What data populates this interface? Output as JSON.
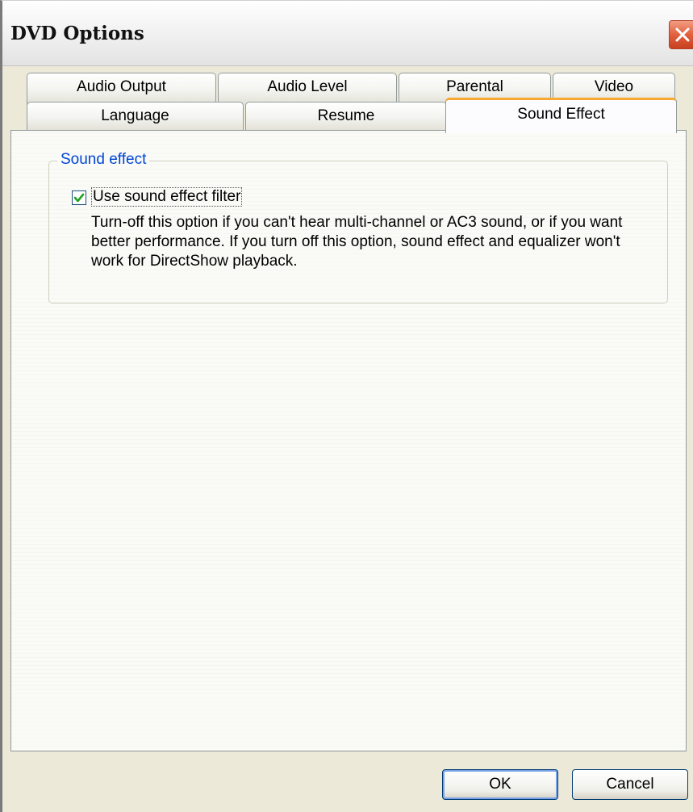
{
  "window": {
    "title": "DVD Options",
    "close_icon": "close-icon"
  },
  "tabs": {
    "row1": [
      "Audio Output",
      "Audio Level",
      "Parental",
      "Video"
    ],
    "row2": [
      "Language",
      "Resume",
      "Sound Effect"
    ],
    "active": "Sound Effect"
  },
  "sound_effect": {
    "group_label": "Sound effect",
    "checkbox_label": "Use sound effect filter",
    "checkbox_checked": true,
    "description": "Turn-off this option if you can't hear multi-channel or AC3 sound, or if you want better performance.  If you turn off this option, sound effect and equalizer won't work for DirectShow playback."
  },
  "buttons": {
    "ok": "OK",
    "cancel": "Cancel"
  },
  "colors": {
    "active_tab_accent": "#f6a92e",
    "group_label": "#0046d5",
    "close_button": "#e2603d"
  }
}
